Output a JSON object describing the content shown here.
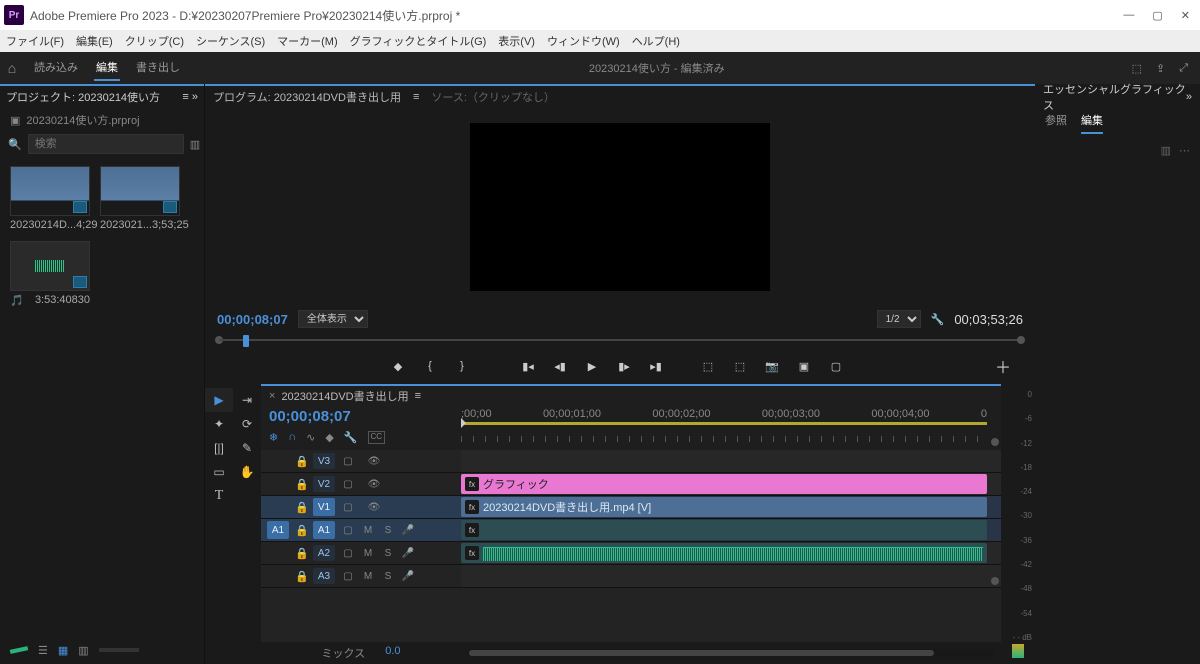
{
  "app": {
    "title": "Adobe Premiere Pro 2023 - D:¥20230207Premiere Pro¥20230214使い方.prproj *",
    "logo": "Pr"
  },
  "menubar": [
    "ファイル(F)",
    "編集(E)",
    "クリップ(C)",
    "シーケンス(S)",
    "マーカー(M)",
    "グラフィックとタイトル(G)",
    "表示(V)",
    "ウィンドウ(W)",
    "ヘルプ(H)"
  ],
  "workspaces": {
    "tabs": [
      "読み込み",
      "編集",
      "書き出し"
    ],
    "active": 1,
    "center": "20230214使い方 - 編集済み"
  },
  "project": {
    "header": "プロジェクト: 20230214使い方",
    "path": "20230214使い方.prproj",
    "search_placeholder": "検索",
    "items": [
      {
        "name": "20230214D...",
        "meta": "4;29"
      },
      {
        "name": "2023021...",
        "meta": "3;53;25"
      },
      {
        "name": "",
        "meta": "3:53:40830"
      }
    ]
  },
  "program": {
    "header": "プログラム: 20230214DVD書き出し用",
    "sourceLabel": "ソース:（クリップなし）",
    "tc": "00;00;08;07",
    "fit": "全体表示",
    "res": "1/2",
    "duration": "00;03;53;26"
  },
  "timeline": {
    "name": "20230214DVD書き出し用",
    "tc": "00;00;08;07",
    "rulerLabels": [
      ";00;00",
      "00;00;01;00",
      "00;00;02;00",
      "00;00;03;00",
      "00;00;04;00",
      "0"
    ],
    "tracks": {
      "v3": "V3",
      "v2": "V2",
      "v1": "V1",
      "a1src": "A1",
      "a1": "A1",
      "a2": "A2",
      "a3": "A3",
      "mix": "ミックス",
      "mixval": "0.0"
    },
    "clips": {
      "graphic": "グラフィック",
      "video": "20230214DVD書き出し用.mp4 [V]"
    }
  },
  "audiometer": [
    "0",
    "-6",
    "-12",
    "-18",
    "-24",
    "-30",
    "-36",
    "-42",
    "-48",
    "-54",
    "- - dB"
  ],
  "eg": {
    "header": "エッセンシャルグラフィックス",
    "tabs": [
      "参照",
      "編集"
    ],
    "active": 1
  }
}
